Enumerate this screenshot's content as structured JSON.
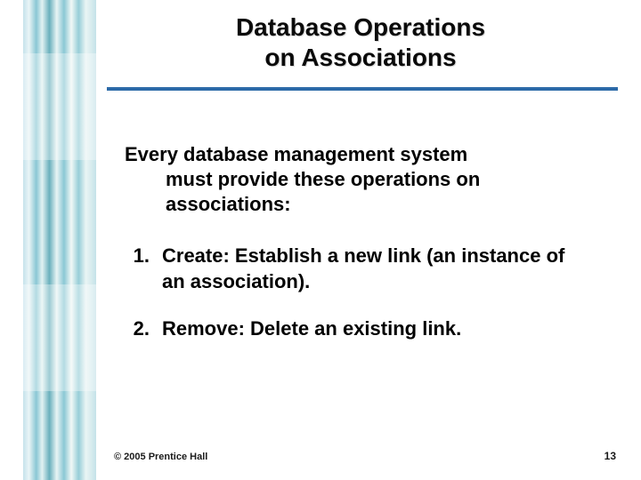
{
  "title": {
    "line1": "Database Operations",
    "line2": "on Associations"
  },
  "intro": {
    "line1": "Every database management system",
    "line2": "must provide these operations on associations:"
  },
  "items": [
    {
      "num": "1.",
      "label": "Create:",
      "text": " Establish a new link (an instance of an association)."
    },
    {
      "num": "2.",
      "label": "Remove:",
      "text": " Delete an existing link."
    }
  ],
  "footer": {
    "copyright": "© 2005  Prentice Hall",
    "page": "13"
  }
}
